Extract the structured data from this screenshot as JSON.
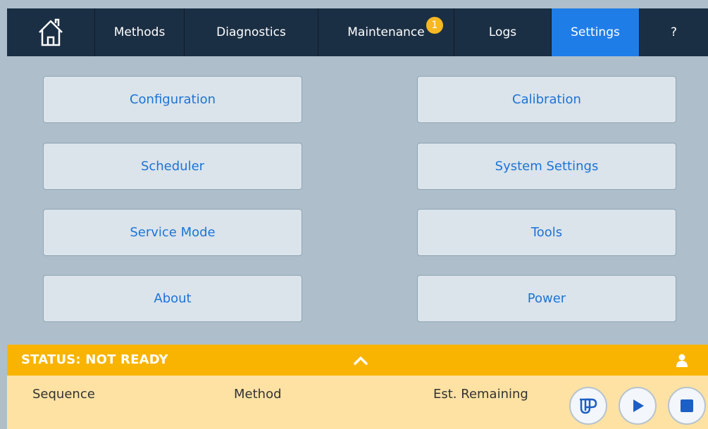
{
  "nav": {
    "home_icon": "home-icon",
    "tabs": [
      {
        "label": "Methods"
      },
      {
        "label": "Diagnostics"
      },
      {
        "label": "Maintenance",
        "badge": "1"
      },
      {
        "label": "Logs"
      },
      {
        "label": "Settings",
        "active": true
      },
      {
        "label": "?"
      }
    ]
  },
  "settings_menu": {
    "left": [
      "Configuration",
      "Scheduler",
      "Service Mode",
      "About"
    ],
    "right": [
      "Calibration",
      "System Settings",
      "Tools",
      "Power"
    ]
  },
  "status": {
    "text": "STATUS: NOT READY",
    "expand_icon": "chevron-up-icon",
    "user_icon": "user-icon"
  },
  "info": {
    "sequence_label": "Sequence",
    "method_label": "Method",
    "remaining_label": "Est. Remaining"
  },
  "controls": {
    "icons": [
      "sample-tube-icon",
      "play-icon",
      "stop-icon"
    ]
  },
  "colors": {
    "nav_bg": "#1b2f44",
    "active_tab": "#1f7de8",
    "badge": "#f8b822",
    "status_bar": "#f8b400",
    "info_bar": "#fde2a4",
    "button_text": "#1d73d6"
  }
}
